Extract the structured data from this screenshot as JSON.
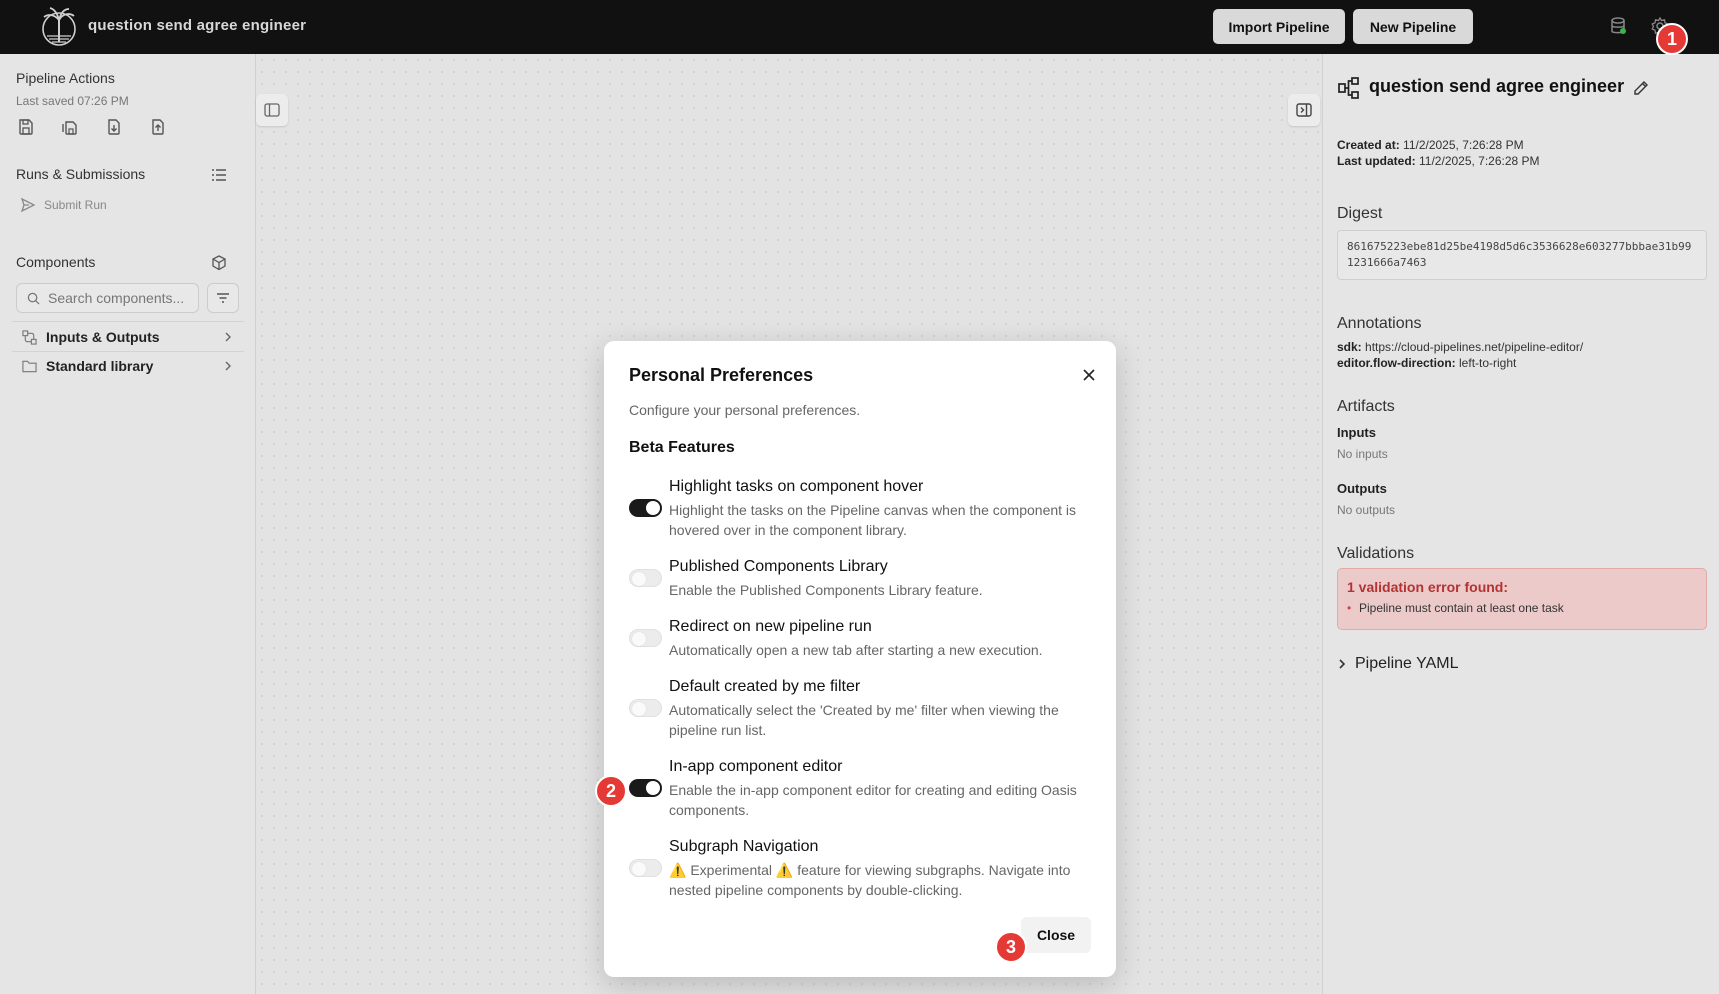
{
  "header": {
    "title": "question send agree engineer",
    "import_label": "Import Pipeline",
    "new_label": "New Pipeline"
  },
  "sidebar": {
    "pipeline_actions_title": "Pipeline Actions",
    "last_saved": "Last saved 07:26 PM",
    "runs_title": "Runs & Submissions",
    "submit_run": "Submit Run",
    "components_title": "Components",
    "search_placeholder": "Search components...",
    "library_items": [
      {
        "label": "Inputs & Outputs"
      },
      {
        "label": "Standard library"
      }
    ]
  },
  "details": {
    "title": "question send agree engineer",
    "created_label": "Created at:",
    "created_value": "11/2/2025, 7:26:28 PM",
    "updated_label": "Last updated:",
    "updated_value": "11/2/2025, 7:26:28 PM",
    "digest_title": "Digest",
    "digest_value": "861675223ebe81d25be4198d5d6c3536628e603277bbbae31b991231666a7463",
    "annotations_title": "Annotations",
    "annotation_sdk_key": "sdk:",
    "annotation_sdk_value": "https://cloud-pipelines.net/pipeline-editor/",
    "annotation_flow_key": "editor.flow-direction:",
    "annotation_flow_value": "left-to-right",
    "artifacts_title": "Artifacts",
    "inputs_label": "Inputs",
    "inputs_value": "No inputs",
    "outputs_label": "Outputs",
    "outputs_value": "No outputs",
    "validations_title": "Validations",
    "validation_error_title": "1 validation error found:",
    "validation_error_item": "Pipeline must contain at least one task",
    "yaml_label": "Pipeline YAML"
  },
  "modal": {
    "title": "Personal Preferences",
    "description": "Configure your personal preferences.",
    "section_title": "Beta Features",
    "close_label": "Close",
    "preferences": [
      {
        "title": "Highlight tasks on component hover",
        "description": "Highlight the tasks on the Pipeline canvas when the component is hovered over in the component library.",
        "enabled": true
      },
      {
        "title": "Published Components Library",
        "description": "Enable the Published Components Library feature.",
        "enabled": false
      },
      {
        "title": "Redirect on new pipeline run",
        "description": "Automatically open a new tab after starting a new execution.",
        "enabled": false
      },
      {
        "title": "Default created by me filter",
        "description": "Automatically select the 'Created by me' filter when viewing the pipeline run list.",
        "enabled": false
      },
      {
        "title": "In-app component editor",
        "description": "Enable the in-app component editor for creating and editing Oasis components.",
        "enabled": true
      },
      {
        "title": "Subgraph Navigation",
        "description": "⚠️ Experimental ⚠️ feature for viewing subgraphs. Navigate into nested pipeline components by double-clicking.",
        "enabled": false
      }
    ]
  },
  "markers": [
    "1",
    "2",
    "3"
  ],
  "colors": {
    "topbar": "#111111",
    "marker": "#e53935",
    "error_text": "#b33333",
    "toggle_on": "#1a1a1a"
  }
}
